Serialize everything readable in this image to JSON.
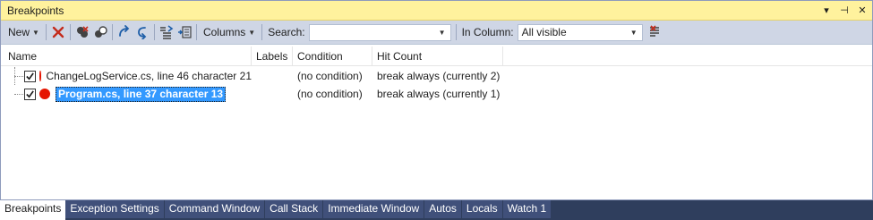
{
  "window": {
    "title": "Breakpoints",
    "title_buttons": [
      "▾",
      "⊣",
      "✕"
    ]
  },
  "toolbar": {
    "new_label": "New",
    "columns_label": "Columns",
    "search_label": "Search:",
    "search_value": "",
    "in_column_label": "In Column:",
    "in_column_value": "All visible"
  },
  "table": {
    "columns": [
      "Name",
      "Labels",
      "Condition",
      "Hit Count"
    ],
    "rows": [
      {
        "name": "ChangeLogService.cs, line 46 character 21",
        "labels": "",
        "condition": "(no condition)",
        "hit_count": "break always (currently 2)",
        "checked": true,
        "selected": false
      },
      {
        "name": "Program.cs, line 37 character 13",
        "labels": "",
        "condition": "(no condition)",
        "hit_count": "break always (currently 1)",
        "checked": true,
        "selected": true
      }
    ]
  },
  "tabs": [
    {
      "label": "Breakpoints",
      "active": true
    },
    {
      "label": "Exception Settings",
      "active": false
    },
    {
      "label": "Command Window",
      "active": false
    },
    {
      "label": "Call Stack",
      "active": false
    },
    {
      "label": "Immediate Window",
      "active": false
    },
    {
      "label": "Autos",
      "active": false
    },
    {
      "label": "Locals",
      "active": false
    },
    {
      "label": "Watch 1",
      "active": false
    }
  ],
  "colors": {
    "title_bar": "#fff29d",
    "toolbar": "#cfd6e5",
    "breakpoint": "#e51400",
    "selection": "#3399ff",
    "tab_strip": "#2f3e5d"
  }
}
